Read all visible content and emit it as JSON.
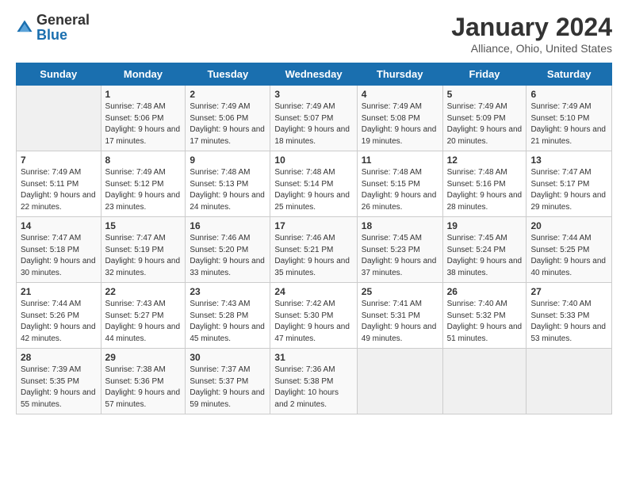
{
  "logo": {
    "general": "General",
    "blue": "Blue"
  },
  "header": {
    "title": "January 2024",
    "subtitle": "Alliance, Ohio, United States"
  },
  "weekdays": [
    "Sunday",
    "Monday",
    "Tuesday",
    "Wednesday",
    "Thursday",
    "Friday",
    "Saturday"
  ],
  "weeks": [
    [
      {
        "day": "",
        "empty": true
      },
      {
        "day": "1",
        "sunrise": "Sunrise: 7:48 AM",
        "sunset": "Sunset: 5:06 PM",
        "daylight": "Daylight: 9 hours and 17 minutes."
      },
      {
        "day": "2",
        "sunrise": "Sunrise: 7:49 AM",
        "sunset": "Sunset: 5:06 PM",
        "daylight": "Daylight: 9 hours and 17 minutes."
      },
      {
        "day": "3",
        "sunrise": "Sunrise: 7:49 AM",
        "sunset": "Sunset: 5:07 PM",
        "daylight": "Daylight: 9 hours and 18 minutes."
      },
      {
        "day": "4",
        "sunrise": "Sunrise: 7:49 AM",
        "sunset": "Sunset: 5:08 PM",
        "daylight": "Daylight: 9 hours and 19 minutes."
      },
      {
        "day": "5",
        "sunrise": "Sunrise: 7:49 AM",
        "sunset": "Sunset: 5:09 PM",
        "daylight": "Daylight: 9 hours and 20 minutes."
      },
      {
        "day": "6",
        "sunrise": "Sunrise: 7:49 AM",
        "sunset": "Sunset: 5:10 PM",
        "daylight": "Daylight: 9 hours and 21 minutes."
      }
    ],
    [
      {
        "day": "7",
        "sunrise": "Sunrise: 7:49 AM",
        "sunset": "Sunset: 5:11 PM",
        "daylight": "Daylight: 9 hours and 22 minutes."
      },
      {
        "day": "8",
        "sunrise": "Sunrise: 7:49 AM",
        "sunset": "Sunset: 5:12 PM",
        "daylight": "Daylight: 9 hours and 23 minutes."
      },
      {
        "day": "9",
        "sunrise": "Sunrise: 7:48 AM",
        "sunset": "Sunset: 5:13 PM",
        "daylight": "Daylight: 9 hours and 24 minutes."
      },
      {
        "day": "10",
        "sunrise": "Sunrise: 7:48 AM",
        "sunset": "Sunset: 5:14 PM",
        "daylight": "Daylight: 9 hours and 25 minutes."
      },
      {
        "day": "11",
        "sunrise": "Sunrise: 7:48 AM",
        "sunset": "Sunset: 5:15 PM",
        "daylight": "Daylight: 9 hours and 26 minutes."
      },
      {
        "day": "12",
        "sunrise": "Sunrise: 7:48 AM",
        "sunset": "Sunset: 5:16 PM",
        "daylight": "Daylight: 9 hours and 28 minutes."
      },
      {
        "day": "13",
        "sunrise": "Sunrise: 7:47 AM",
        "sunset": "Sunset: 5:17 PM",
        "daylight": "Daylight: 9 hours and 29 minutes."
      }
    ],
    [
      {
        "day": "14",
        "sunrise": "Sunrise: 7:47 AM",
        "sunset": "Sunset: 5:18 PM",
        "daylight": "Daylight: 9 hours and 30 minutes."
      },
      {
        "day": "15",
        "sunrise": "Sunrise: 7:47 AM",
        "sunset": "Sunset: 5:19 PM",
        "daylight": "Daylight: 9 hours and 32 minutes."
      },
      {
        "day": "16",
        "sunrise": "Sunrise: 7:46 AM",
        "sunset": "Sunset: 5:20 PM",
        "daylight": "Daylight: 9 hours and 33 minutes."
      },
      {
        "day": "17",
        "sunrise": "Sunrise: 7:46 AM",
        "sunset": "Sunset: 5:21 PM",
        "daylight": "Daylight: 9 hours and 35 minutes."
      },
      {
        "day": "18",
        "sunrise": "Sunrise: 7:45 AM",
        "sunset": "Sunset: 5:23 PM",
        "daylight": "Daylight: 9 hours and 37 minutes."
      },
      {
        "day": "19",
        "sunrise": "Sunrise: 7:45 AM",
        "sunset": "Sunset: 5:24 PM",
        "daylight": "Daylight: 9 hours and 38 minutes."
      },
      {
        "day": "20",
        "sunrise": "Sunrise: 7:44 AM",
        "sunset": "Sunset: 5:25 PM",
        "daylight": "Daylight: 9 hours and 40 minutes."
      }
    ],
    [
      {
        "day": "21",
        "sunrise": "Sunrise: 7:44 AM",
        "sunset": "Sunset: 5:26 PM",
        "daylight": "Daylight: 9 hours and 42 minutes."
      },
      {
        "day": "22",
        "sunrise": "Sunrise: 7:43 AM",
        "sunset": "Sunset: 5:27 PM",
        "daylight": "Daylight: 9 hours and 44 minutes."
      },
      {
        "day": "23",
        "sunrise": "Sunrise: 7:43 AM",
        "sunset": "Sunset: 5:28 PM",
        "daylight": "Daylight: 9 hours and 45 minutes."
      },
      {
        "day": "24",
        "sunrise": "Sunrise: 7:42 AM",
        "sunset": "Sunset: 5:30 PM",
        "daylight": "Daylight: 9 hours and 47 minutes."
      },
      {
        "day": "25",
        "sunrise": "Sunrise: 7:41 AM",
        "sunset": "Sunset: 5:31 PM",
        "daylight": "Daylight: 9 hours and 49 minutes."
      },
      {
        "day": "26",
        "sunrise": "Sunrise: 7:40 AM",
        "sunset": "Sunset: 5:32 PM",
        "daylight": "Daylight: 9 hours and 51 minutes."
      },
      {
        "day": "27",
        "sunrise": "Sunrise: 7:40 AM",
        "sunset": "Sunset: 5:33 PM",
        "daylight": "Daylight: 9 hours and 53 minutes."
      }
    ],
    [
      {
        "day": "28",
        "sunrise": "Sunrise: 7:39 AM",
        "sunset": "Sunset: 5:35 PM",
        "daylight": "Daylight: 9 hours and 55 minutes."
      },
      {
        "day": "29",
        "sunrise": "Sunrise: 7:38 AM",
        "sunset": "Sunset: 5:36 PM",
        "daylight": "Daylight: 9 hours and 57 minutes."
      },
      {
        "day": "30",
        "sunrise": "Sunrise: 7:37 AM",
        "sunset": "Sunset: 5:37 PM",
        "daylight": "Daylight: 9 hours and 59 minutes."
      },
      {
        "day": "31",
        "sunrise": "Sunrise: 7:36 AM",
        "sunset": "Sunset: 5:38 PM",
        "daylight": "Daylight: 10 hours and 2 minutes."
      },
      {
        "day": "",
        "empty": true
      },
      {
        "day": "",
        "empty": true
      },
      {
        "day": "",
        "empty": true
      }
    ]
  ]
}
